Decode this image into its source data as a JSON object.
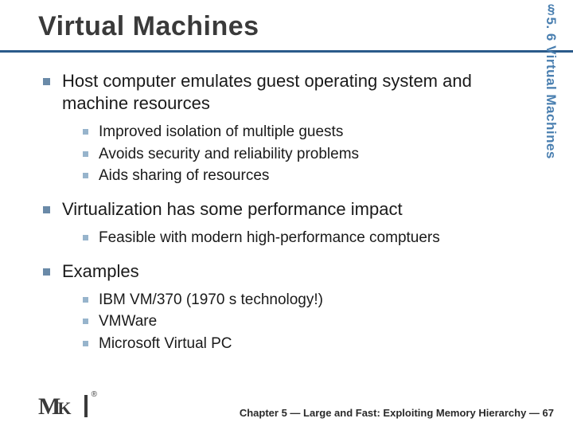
{
  "title": "Virtual Machines",
  "side_tab": "§5. 6 Virtual Machines",
  "bullets": {
    "b1": "Host computer emulates guest operating system and machine resources",
    "b1_sub": {
      "s1": "Improved isolation of multiple guests",
      "s2": "Avoids security and reliability problems",
      "s3": "Aids sharing of resources"
    },
    "b2": "Virtualization has some performance impact",
    "b2_sub": {
      "s1": "Feasible with modern high-performance comptuers"
    },
    "b3": "Examples",
    "b3_sub": {
      "s1": "IBM VM/370 (1970 s technology!)",
      "s2": "VMWare",
      "s3": "Microsoft Virtual PC"
    }
  },
  "footer": "Chapter 5 — Large and Fast: Exploiting Memory Hierarchy — 67",
  "logo": {
    "m": "M",
    "k": "K",
    "reg": "®"
  }
}
